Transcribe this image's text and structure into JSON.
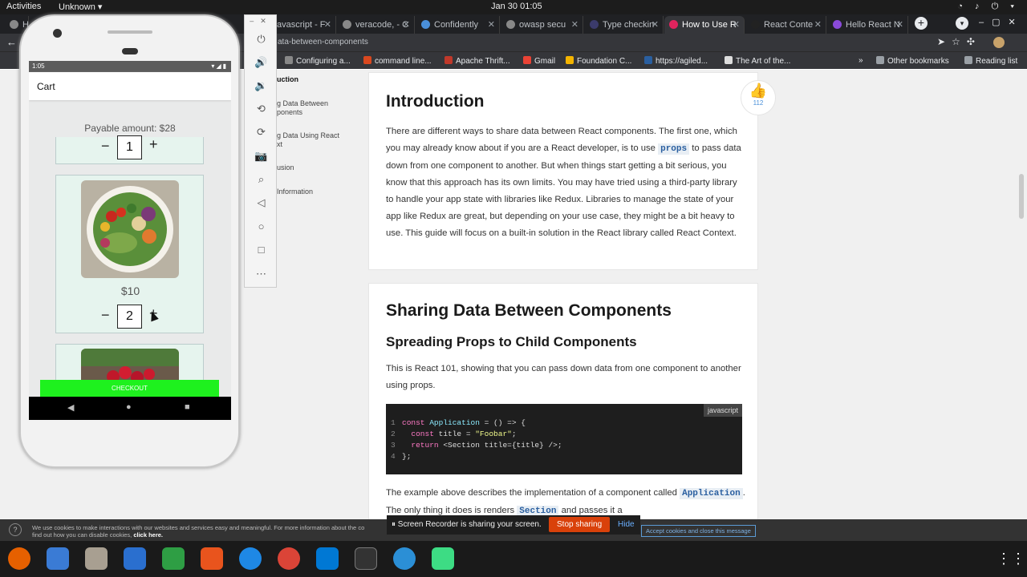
{
  "system": {
    "activities": "Activities",
    "unknown": "Unknown ▾",
    "clock": "Jan 30  01:05",
    "tray": "◔ ♪ ⏻ ▾"
  },
  "browser": {
    "tabs": [
      {
        "label": "H"
      },
      {
        "label": "avascript - F"
      },
      {
        "label": "veracode, - C"
      },
      {
        "label": "Confidently"
      },
      {
        "label": "owasp secu"
      },
      {
        "label": "Type checkin"
      },
      {
        "label": "How to Use R"
      },
      {
        "label": "React Conte"
      },
      {
        "label": "Hello React N"
      }
    ],
    "url": "ata-between-components",
    "bookmarks": [
      "Configuring a...",
      "command line...",
      "Apache Thrift...",
      "Gmail",
      "Foundation C...",
      "https://agiled...",
      "The Art of the..."
    ],
    "other_bookmarks": "Other bookmarks",
    "reading_list": "Reading list"
  },
  "toc": {
    "items": [
      "uction",
      "g Data Between",
      "ponents",
      "g Data Using React",
      "xt",
      "usion",
      "Information"
    ]
  },
  "article": {
    "intro_title": "Introduction",
    "intro_p1_a": "There are different ways to share data between React components. The first one, which you may already know about if you are a React developer, is to use ",
    "intro_code": "props",
    "intro_p1_b": " to pass data down from one component to another. But when things start getting a bit serious, you know that this approach has its own limits. You may have tried using a third-party library to handle your app state with libraries like Redux. Libraries to manage the state of your app like Redux are great, but depending on your use case, they might be a bit heavy to use. This guide will focus on a built-in solution in the React library called React Context.",
    "share_title": "Sharing Data Between Components",
    "spread_title": "Spreading Props to Child Components",
    "spread_p": "This is React 101, showing that you can pass down data from one component to another using props.",
    "code_lang": "javascript",
    "code_lines": [
      {
        "n": "1"
      },
      {
        "n": "2"
      },
      {
        "n": "3"
      },
      {
        "n": "4"
      }
    ],
    "example_a": "The example above describes the implementation of a component called ",
    "example_code1": "Application",
    "example_b": ". The only thing it does is renders ",
    "example_code2": "Section",
    "example_c": " and passes it a",
    "likes": "112"
  },
  "cookie": {
    "text1": "We use cookies to make interactions with our websites and services easy and meaningful. For more information about the co",
    "text2": "find out how you can disable cookies, ",
    "link": "click here.",
    "accept": "Accept cookies and close this message"
  },
  "recorder": {
    "msg": "⏸  Screen Recorder is sharing your screen.",
    "stop": "Stop sharing",
    "hide": "Hide"
  },
  "phone": {
    "time": "1:05",
    "title": "Cart",
    "payable": "Payable amount: $28",
    "item1_qty": "1",
    "item2_price": "$10",
    "item2_qty": "2",
    "checkout": "CHECKOUT"
  }
}
